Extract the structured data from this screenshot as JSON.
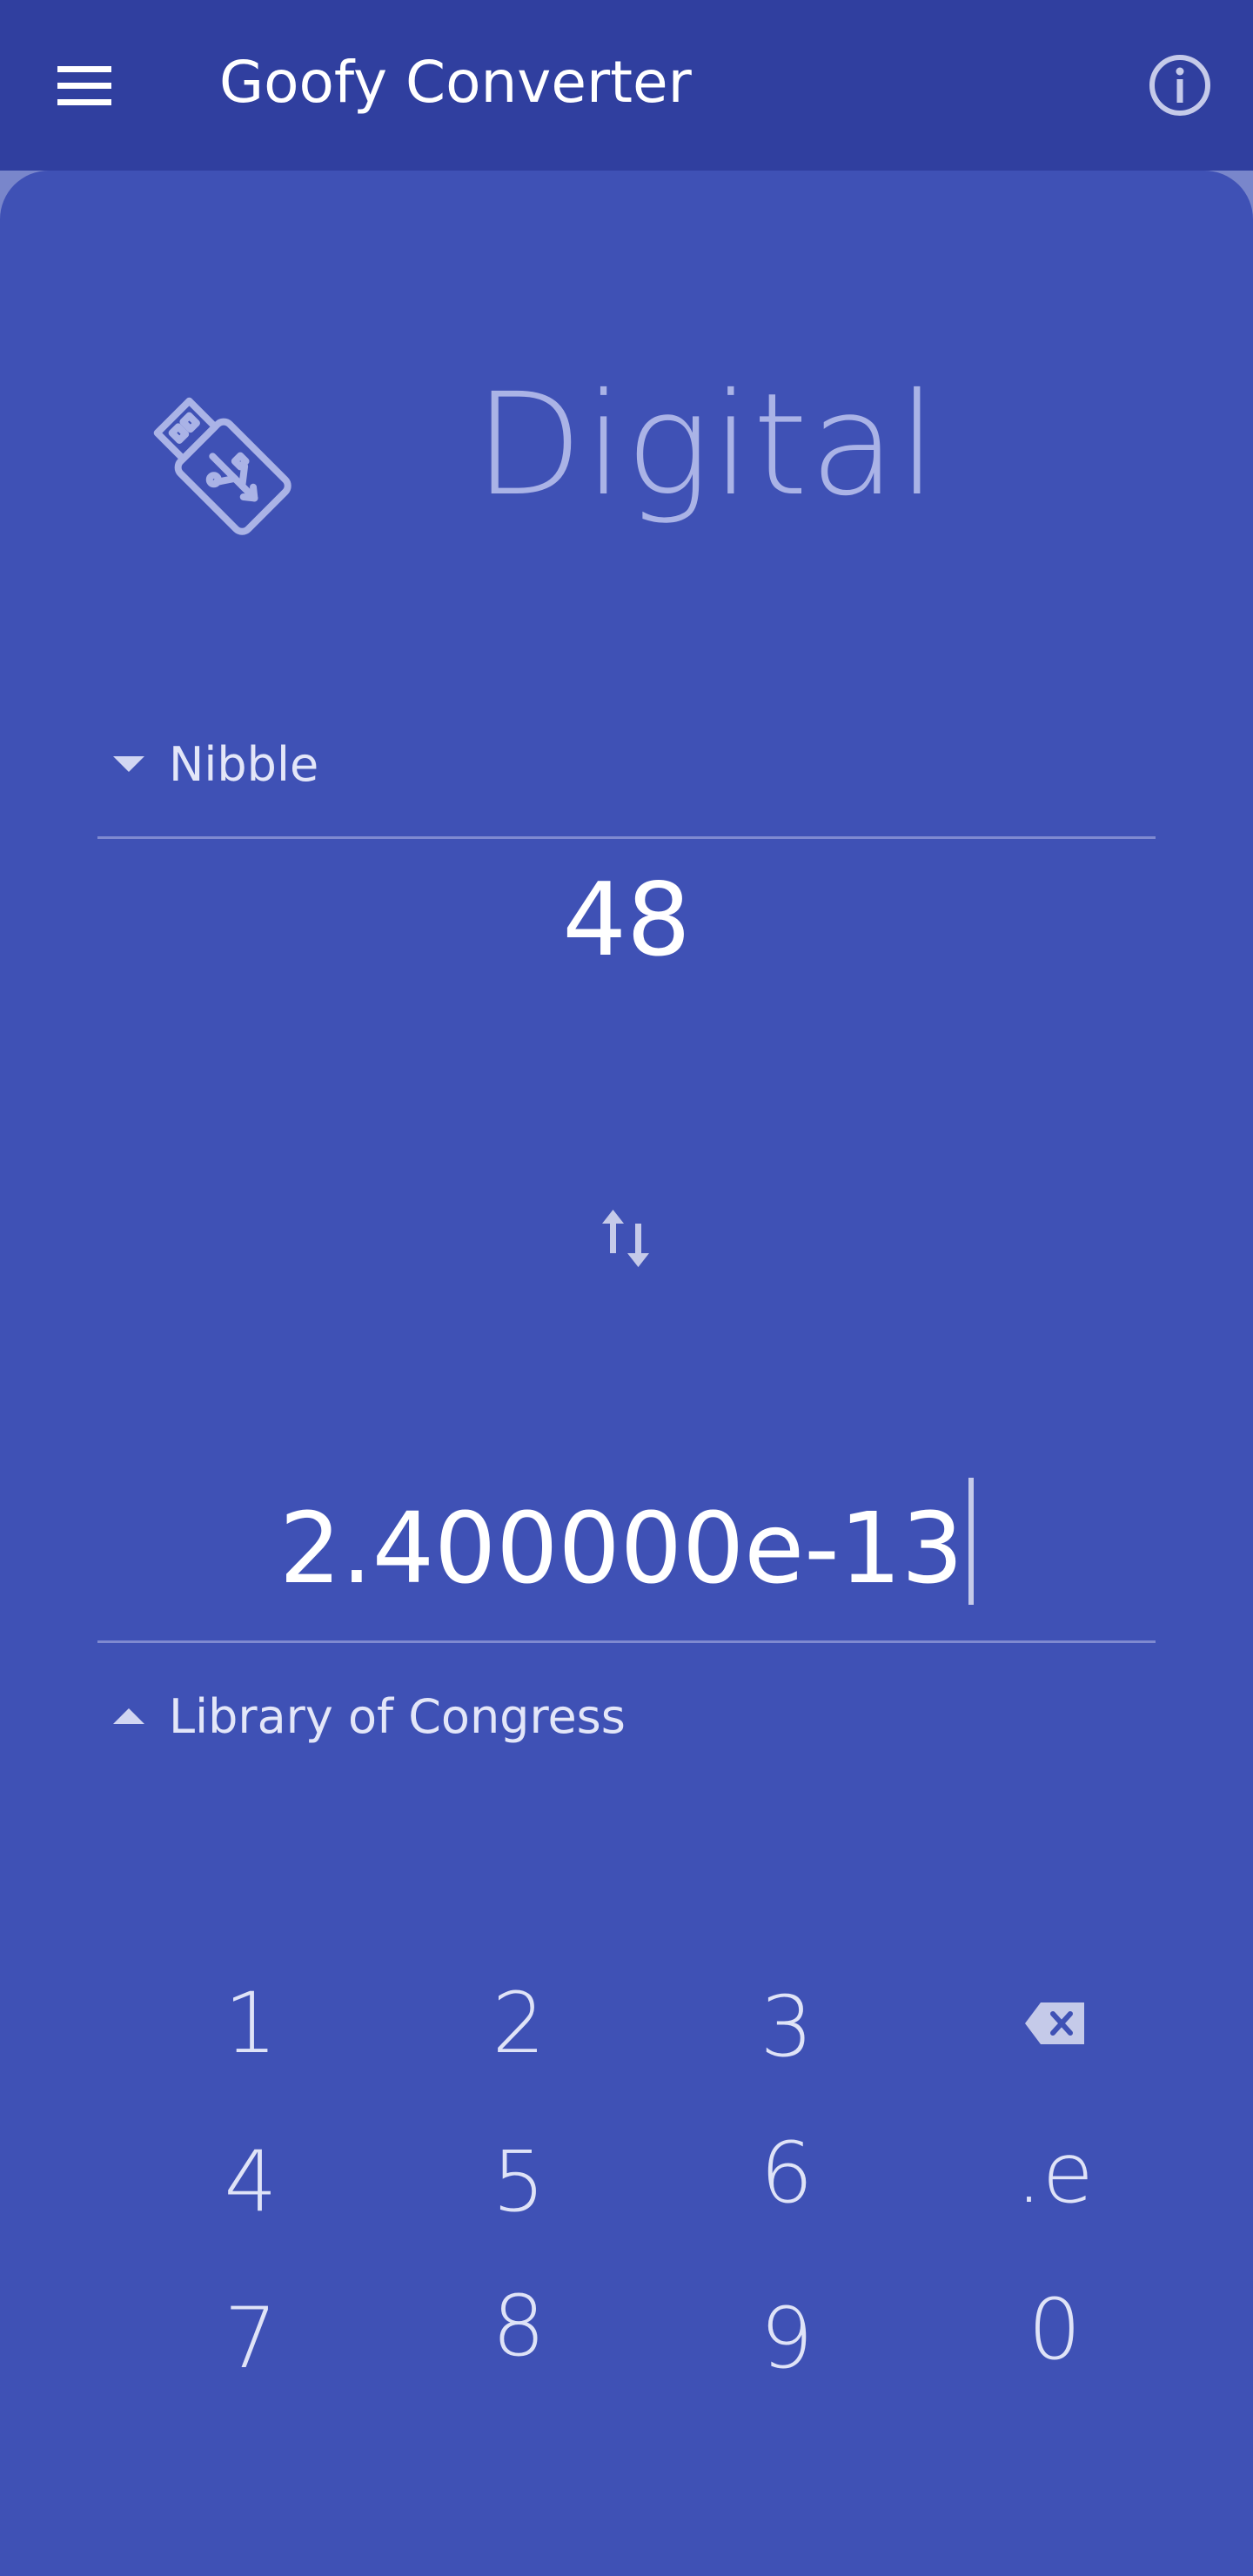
{
  "app_bar": {
    "title": "Goofy Converter",
    "menu_icon": "hamburger-menu-icon",
    "info_icon": "info-circle-icon"
  },
  "category": {
    "icon": "usb-drive-icon",
    "title": "Digital"
  },
  "converter": {
    "from_unit": "Nibble",
    "from_value": "48",
    "swap_icon": "swap-vertical-icon",
    "to_value": "2.400000e-13",
    "to_unit": "Library of Congress"
  },
  "keypad": {
    "keys": [
      "1",
      "2",
      "3",
      "4",
      "5",
      "6",
      ".e",
      "7",
      "8",
      "9",
      "0"
    ],
    "backspace_icon": "backspace-icon"
  },
  "colors": {
    "app_bar": "#303f9f",
    "background": "#3f51b5",
    "accent_light": "#c5cae9"
  }
}
